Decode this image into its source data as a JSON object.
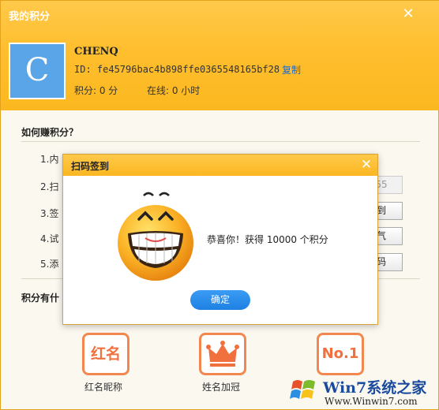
{
  "window": {
    "title": "我的积分",
    "close_glyph": "✕"
  },
  "profile": {
    "avatar_letter": "C",
    "avatar_color": "#5aa5e8",
    "username": "CHENQ",
    "id_text": "ID: fe45796bac4b898ffe0365548165bf28",
    "copy_label": "复制",
    "points_text": "积分: 0 分",
    "online_text": "在线: 0 小时"
  },
  "earn": {
    "title": "如何赚积分？",
    "tasks": [
      {
        "label": "1.内",
        "button": null
      },
      {
        "label": "2.扫",
        "button": "55"
      },
      {
        "label": "3.签",
        "button": "到"
      },
      {
        "label": "4.试",
        "button": "气"
      },
      {
        "label": "5.添",
        "button": "码"
      }
    ]
  },
  "use": {
    "title": "积分有什"
  },
  "privileges": [
    {
      "icon_text": "红名",
      "label": "红名昵称",
      "icon": "red-name-icon"
    },
    {
      "icon_text": "",
      "label": "姓名加冠",
      "icon": "crown-icon"
    },
    {
      "icon_text": "No.1",
      "label": "",
      "icon": "no1-icon"
    }
  ],
  "dialog": {
    "title": "扫码签到",
    "close_glyph": "✕",
    "message": "恭喜你！获得 10000 个积分",
    "ok_label": "确定",
    "accent": "#1e80e2"
  },
  "watermark": {
    "brand": "Win7系统之家",
    "url": "Www.Winwin7.com"
  },
  "colors": {
    "header": "#ffc13a",
    "privilege_orange": "#f2884f",
    "link": "#1a6ad6"
  }
}
